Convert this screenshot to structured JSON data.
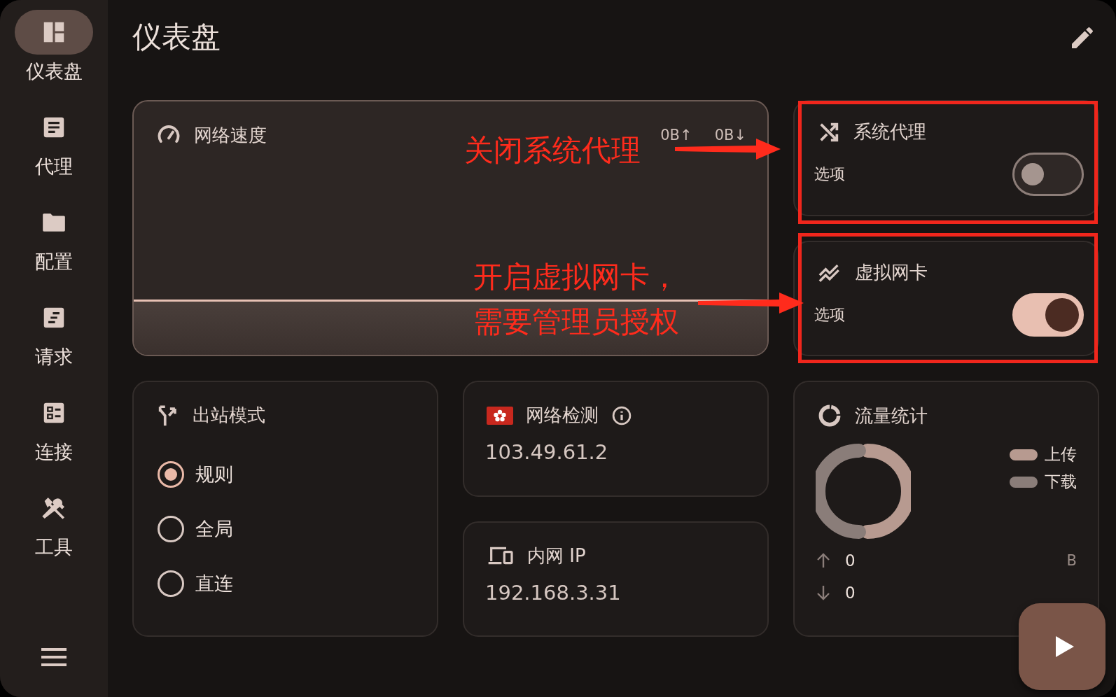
{
  "sidebar": {
    "items": [
      {
        "label": "仪表盘",
        "kind": "dashboard",
        "selected": true
      },
      {
        "label": "代理",
        "kind": "list",
        "selected": false
      },
      {
        "label": "配置",
        "kind": "folder",
        "selected": false
      },
      {
        "label": "请求",
        "kind": "requests",
        "selected": false
      },
      {
        "label": "连接",
        "kind": "connections",
        "selected": false
      },
      {
        "label": "工具",
        "kind": "tools",
        "selected": false
      }
    ]
  },
  "header": {
    "title": "仪表盘"
  },
  "network_speed": {
    "title": "网络速度",
    "upload": "0B↑",
    "download": "0B↓"
  },
  "switches": [
    {
      "title": "系统代理",
      "kind": "shuffle",
      "label": "选项",
      "on": false
    },
    {
      "title": "虚拟网卡",
      "kind": "trend",
      "label": "选项",
      "on": true
    }
  ],
  "outbound_mode": {
    "title": "出站模式",
    "options": [
      {
        "label": "规则",
        "selected": true
      },
      {
        "label": "全局",
        "selected": false
      },
      {
        "label": "直连",
        "selected": false
      }
    ]
  },
  "network_check": {
    "title": "网络检测",
    "ip": "103.49.61.2"
  },
  "lan_ip": {
    "title": "内网 IP",
    "ip": "192.168.3.31"
  },
  "traffic": {
    "title": "流量统计",
    "legend": [
      {
        "label": "上传",
        "color": "#b79a90"
      },
      {
        "label": "下载",
        "color": "#8a7d79"
      }
    ],
    "upload": "0",
    "download": "0",
    "upload_unit": "B"
  },
  "annotations": [
    {
      "lines": [
        "关闭系统代理"
      ]
    },
    {
      "lines": [
        "开启虚拟网卡，",
        "需要管理员授权"
      ]
    }
  ]
}
